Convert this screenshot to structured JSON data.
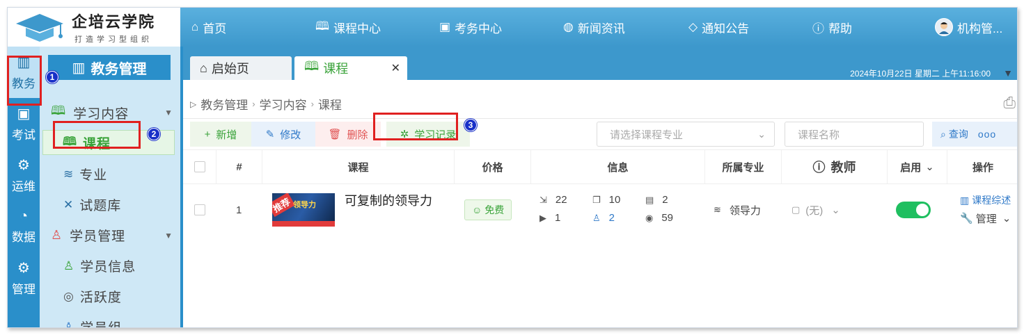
{
  "brand": {
    "name": "企培云学院",
    "slogan": "打造学习型组织"
  },
  "topnav": {
    "items": [
      {
        "label": "首页",
        "icon": "home-icon"
      },
      {
        "label": "课程中心",
        "icon": "book-icon"
      },
      {
        "label": "考务中心",
        "icon": "exam-icon"
      },
      {
        "label": "新闻资讯",
        "icon": "news-icon"
      },
      {
        "label": "通知公告",
        "icon": "bell-icon"
      },
      {
        "label": "帮助",
        "icon": "help-icon"
      }
    ],
    "user": "机构管..."
  },
  "rail": [
    {
      "label": "教务",
      "icon": "library-icon",
      "active": true
    },
    {
      "label": "考试",
      "icon": "exam-icon"
    },
    {
      "label": "运维",
      "icon": "ops-icon"
    },
    {
      "label": "数据",
      "icon": "pie-chart-icon"
    },
    {
      "label": "管理",
      "icon": "gear-icon"
    }
  ],
  "subbar": {
    "title": "教务管理",
    "groups": {
      "learning": "学习内容",
      "students": "学员管理"
    },
    "items": {
      "course": "课程",
      "major": "专业",
      "questions": "试题库",
      "student_info": "学员信息",
      "activity": "活跃度",
      "student_group": "学员组"
    }
  },
  "tabs": {
    "home": "启始页",
    "course": "课程"
  },
  "clock": "2024年10月22日 星期二 上午11:16:00",
  "breadcrumb": [
    "教务管理",
    "学习内容",
    "课程"
  ],
  "toolbar": {
    "add": "新增",
    "edit": "修改",
    "delete": "删除",
    "study_log": "学习记录",
    "major_placeholder": "请选择课程专业",
    "name_placeholder": "课程名称",
    "query": "查询",
    "more": "ooo"
  },
  "table": {
    "headers": {
      "index": "#",
      "course": "课程",
      "price": "价格",
      "info": "信息",
      "major": "所属专业",
      "teacher": "教师",
      "enabled": "启用",
      "action": "操作"
    },
    "rows": [
      {
        "index": "1",
        "thumb_badge": "推荐",
        "thumb_title": "领导力",
        "title": "可复制的领导力",
        "price": "免费",
        "stats": {
          "a": "22",
          "b": "10",
          "c": "2",
          "d": "1",
          "e": "2",
          "f": "59"
        },
        "major": "领导力",
        "teacher": "(无)",
        "enabled": true,
        "action_summary": "课程综述",
        "action_manage": "管理"
      }
    ]
  },
  "callouts": [
    "1",
    "2",
    "3"
  ],
  "colors": {
    "primary": "#2a8fca",
    "green": "#3aa33a",
    "red": "#e02020",
    "toggle": "#1fbf60"
  }
}
